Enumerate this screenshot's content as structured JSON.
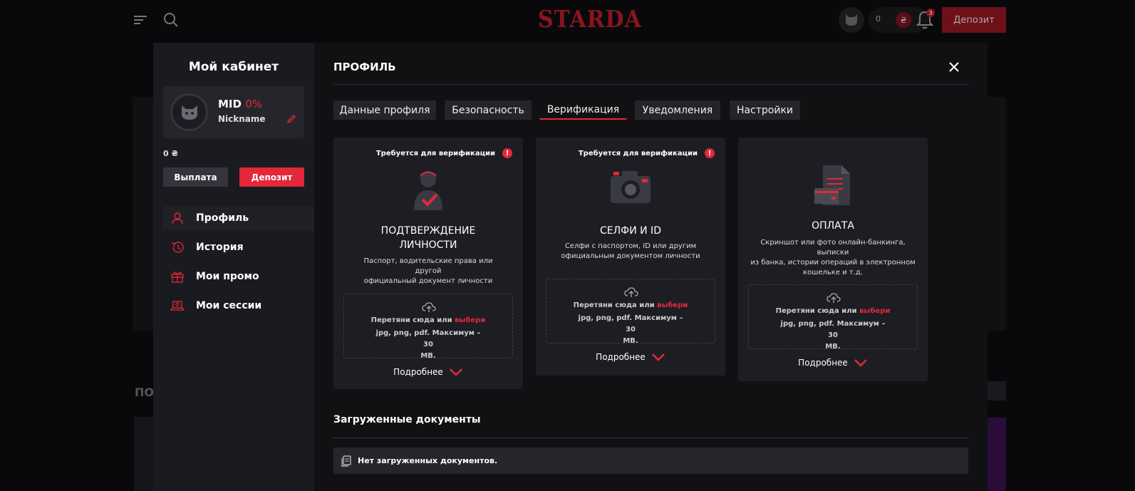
{
  "header": {
    "logo": "STARDA",
    "balance": "0",
    "coin_symbol": "₴",
    "notifications_count": "3",
    "deposit_label": "Депозит"
  },
  "background": {
    "section_title_fragment": "ПО"
  },
  "sidebar": {
    "title": "Мой кабинет",
    "user": {
      "mid_label": "MID",
      "mid_percent": "0%",
      "nickname": "Nickname"
    },
    "balance": "0 ₴",
    "withdraw_label": "Выплата",
    "deposit_label": "Депозит",
    "menu": [
      {
        "label": "Профиль",
        "icon": "user-icon"
      },
      {
        "label": "История",
        "icon": "history-icon"
      },
      {
        "label": "Мои промо",
        "icon": "gift-icon"
      },
      {
        "label": "Мои сессии",
        "icon": "laptop-icon"
      }
    ]
  },
  "panel": {
    "title": "ПРОФИЛЬ",
    "tabs": [
      {
        "label": "Данные профиля",
        "active": false
      },
      {
        "label": "Безопасность",
        "active": false
      },
      {
        "label": "Верификация",
        "active": true
      },
      {
        "label": "Уведомления",
        "active": false
      },
      {
        "label": "Настройки",
        "active": false
      }
    ],
    "cards": [
      {
        "required": "Требуется для верификации",
        "title_line1": "ПОДТВЕРЖДЕНИЕ",
        "title_line2": "ЛИЧНОСТИ",
        "desc_line1": "Паспорт, водительские права или другой",
        "desc_line2": "официальный документ личности",
        "drop_text": "Перетяни сюда или",
        "drop_select": "выбери",
        "drop_formats_line1": "jpg, png, pdf. Максимум – 30",
        "drop_formats_line2": "MB.",
        "more": "Подробнее"
      },
      {
        "required": "Требуется для верификации",
        "title_line1": "СЕЛФИ И ID",
        "desc_line1": "Селфи с паспортом, ID или другим",
        "desc_line2": "официальным документом личности",
        "drop_text": "Перетяни сюда или",
        "drop_select": "выбери",
        "drop_formats_line1": "jpg, png, pdf. Максимум – 30",
        "drop_formats_line2": "MB.",
        "more": "Подробнее"
      },
      {
        "title_line1": "ОПЛАТА",
        "desc_line1": "Скриншот или фото онлайн-банкинга, выписки",
        "desc_line2": "из банка, истории операций в электронном",
        "desc_line3": "кошельке и т.д.",
        "drop_text": "Перетяни сюда или",
        "drop_select": "выбери",
        "drop_formats_line1": "jpg, png, pdf. Максимум – 30",
        "drop_formats_line2": "MB.",
        "more": "Подробнее"
      }
    ],
    "uploaded_title": "Загруженные документы",
    "no_documents": "Нет загруженных документов."
  },
  "colors": {
    "accent": "#e2283a",
    "panel_bg": "#111114",
    "sidebar_bg": "#1a1b20",
    "card_bg": "#1d1e23"
  }
}
